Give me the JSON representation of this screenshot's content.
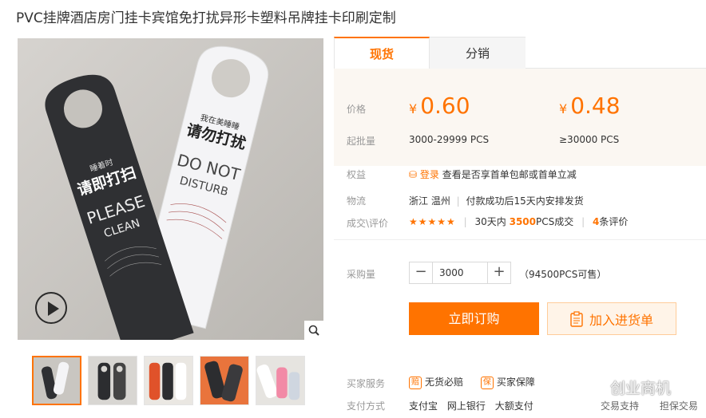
{
  "product": {
    "title": "PVC挂牌酒店房门挂卡宾馆免打扰异形卡塑料吊牌挂卡印刷定制"
  },
  "media": {
    "play_icon": "play-icon",
    "zoom_icon": "magnifier-icon",
    "sign_dark": {
      "small": "睡着时",
      "big": "请即打扫",
      "en1": "PLEASE",
      "en2": "CLEAN"
    },
    "sign_light": {
      "small": "我在美睡睡",
      "big": "请勿打扰",
      "en1": "DO NOT",
      "en2": "DISTURB"
    },
    "thumb_count": 5
  },
  "tabs": [
    {
      "label": "现货"
    },
    {
      "label": "分销"
    }
  ],
  "pricing": {
    "price_label": "价格",
    "currency": "¥",
    "tiers": [
      {
        "price": "0.60",
        "range": "3000-29999 PCS"
      },
      {
        "price": "0.48",
        "range": "≥30000 PCS"
      }
    ],
    "moq_label": "起批量"
  },
  "benefits": {
    "label": "权益",
    "login_link": "登录",
    "text": "查看是否享首单包邮或首单立减"
  },
  "logistics": {
    "label": "物流",
    "origin": "浙江 温州",
    "note": "付款成功后15天内安排发货"
  },
  "reviews": {
    "label": "成交\\评价",
    "stars": "★★★★★",
    "prefix": "30天内",
    "count": "3500",
    "unit": "PCS成交",
    "review_count": "4",
    "review_suffix": "条评价"
  },
  "purchase": {
    "label": "采购量",
    "quantity": "3000",
    "minus": "−",
    "plus": "+",
    "stock": "（94500PCS可售）",
    "buy_label": "立即订购",
    "cart_label": "加入进货单"
  },
  "services": {
    "label": "买家服务",
    "items": [
      "无货必赔",
      "买家保障"
    ],
    "pay_label": "支付方式",
    "pay_methods": [
      "支付宝",
      "网上银行",
      "大额支付"
    ],
    "tail": [
      "交易支持",
      "担保交易"
    ]
  },
  "watermark": {
    "text": "创业商机"
  },
  "colors": {
    "accent": "#ff7300",
    "price_bg": "#fbf7f2"
  }
}
